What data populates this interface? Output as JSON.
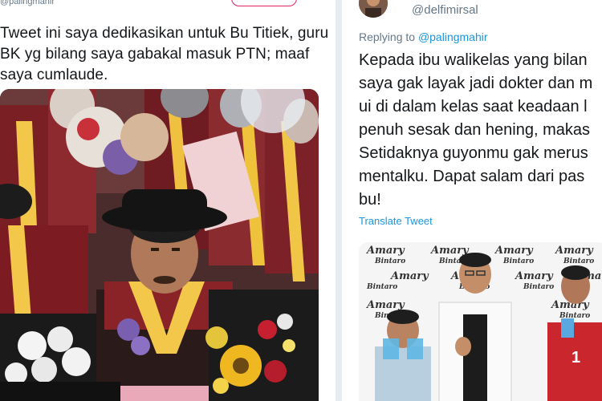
{
  "left_tweet": {
    "handle": "@palingmahir",
    "text": "Tweet ini saya dedikasikan untuk Bu Titiek, guru BK yg bilang saya gabakal masuk PTN; maaf saya cumlaude."
  },
  "right_tweet": {
    "handle": "@delfimirsal",
    "replying_prefix": "Replying to",
    "replying_to": "@palingmahir",
    "text_lines": [
      "Kepada ibu walikelas yang bilan",
      "saya gak layak jadi dokter dan m",
      "ui di dalam kelas saat keadaan l",
      "penuh sesak dan hening, makas",
      "Setidaknya guyonmu gak merus",
      "mentalku. Dapat salam dari pas",
      "bu!"
    ],
    "translate_label": "Translate Tweet",
    "photo_logo": {
      "brand": "Amary",
      "sub": "Bintaro"
    }
  },
  "colors": {
    "text": "#14171a",
    "muted": "#657786",
    "link": "#1b95e0",
    "divider": "#e6ecf0"
  }
}
